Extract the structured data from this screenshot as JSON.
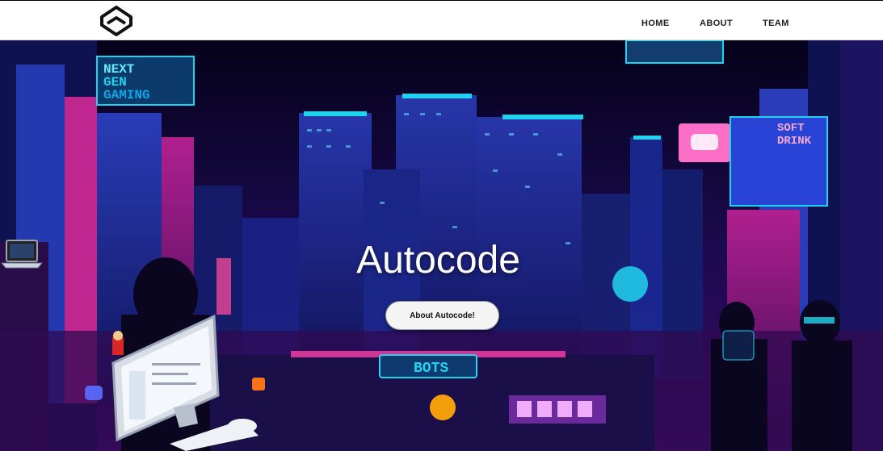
{
  "nav": {
    "home": "HOME",
    "about": "ABOUT",
    "team": "TEAM"
  },
  "hero": {
    "title": "Autocode",
    "button_label": "About Autocode!",
    "signs": {
      "next_gen": [
        "NEXT",
        "GEN",
        "GAMING"
      ],
      "soft_drink": [
        "SOFT",
        "DRINK"
      ],
      "bots": "BOTS"
    }
  },
  "colors": {
    "navbar_bg": "#ffffff",
    "nav_text": "#1f1f1f",
    "neon_cyan": "#22d3ee",
    "neon_pink": "#ff3fa4",
    "neon_blue": "#2f5bff",
    "deep_navy": "#0b0620"
  }
}
